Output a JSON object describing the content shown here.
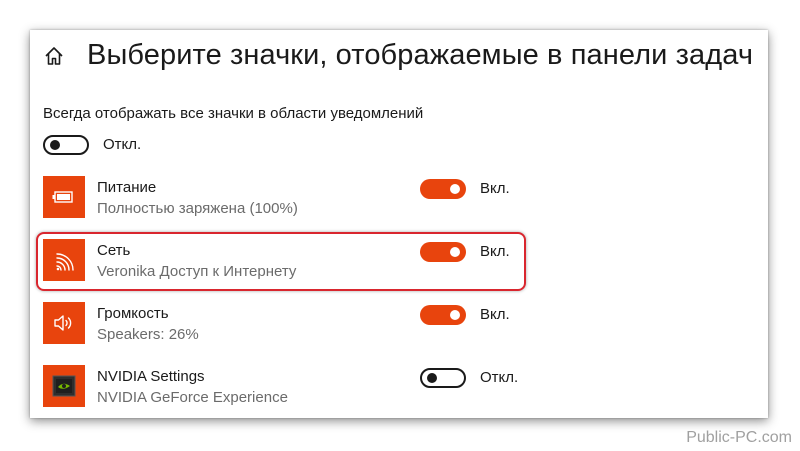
{
  "header": {
    "home_icon": "home-icon",
    "title": "Выберите значки, отображаемые в панели задач"
  },
  "always_show": {
    "label": "Всегда отображать все значки в области уведомлений",
    "state": "Откл."
  },
  "items": [
    {
      "icon": "battery-icon",
      "name": "Питание",
      "status": "Полностью заряжена (100%)",
      "toggle": "Вкл."
    },
    {
      "icon": "wifi-icon",
      "name": "Сеть",
      "status": "Veronika Доступ к Интернету",
      "toggle": "Вкл."
    },
    {
      "icon": "speaker-icon",
      "name": "Громкость",
      "status": "Speakers: 26%",
      "toggle": "Вкл."
    },
    {
      "icon": "nvidia-icon",
      "name": "NVIDIA Settings",
      "status": "NVIDIA GeForce Experience",
      "toggle": "Откл."
    }
  ],
  "colors": {
    "accent": "#e8440d",
    "highlight": "#d9262e"
  },
  "watermark": "Public-PC.com"
}
